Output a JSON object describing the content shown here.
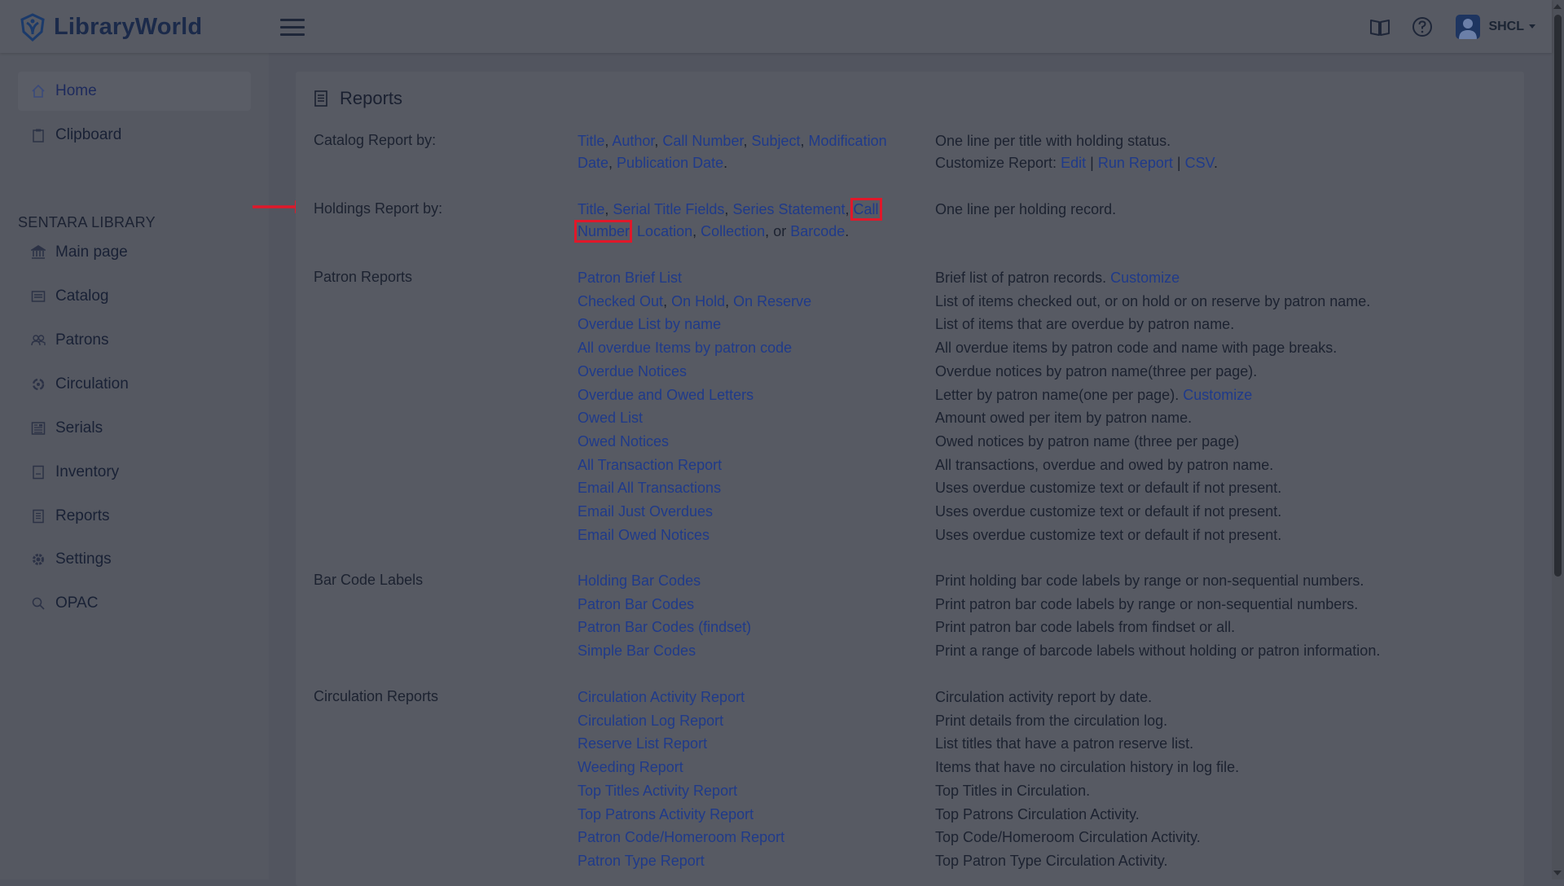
{
  "brand": {
    "name": "LibraryWorld"
  },
  "user": {
    "name": "SHCL"
  },
  "colors": {
    "link": "#1f3a8a",
    "highlight": "#e0182a",
    "brand": "#1b2a4a"
  },
  "sidebar": {
    "section": "SENTARA LIBRARY",
    "items": [
      {
        "label": "Home",
        "icon": "home-icon"
      },
      {
        "label": "Clipboard",
        "icon": "clipboard-icon"
      },
      {
        "label": "Main page",
        "icon": "bank-icon"
      },
      {
        "label": "Catalog",
        "icon": "catalog-icon"
      },
      {
        "label": "Patrons",
        "icon": "users-icon"
      },
      {
        "label": "Circulation",
        "icon": "circulation-icon"
      },
      {
        "label": "Serials",
        "icon": "serials-icon"
      },
      {
        "label": "Inventory",
        "icon": "inventory-icon"
      },
      {
        "label": "Reports",
        "icon": "reports-icon"
      },
      {
        "label": "Settings",
        "icon": "gear-icon"
      },
      {
        "label": "OPAC",
        "icon": "search-icon"
      }
    ]
  },
  "page": {
    "title": "Reports"
  },
  "catalog": {
    "label": "Catalog Report by:",
    "links": [
      "Title",
      "Author",
      "Call Number",
      "Subject",
      "Modification",
      "Date",
      "Publication Date"
    ],
    "desc1": "One line per title with holding status.",
    "desc2_prefix": "Customize Report:",
    "edit": "Edit",
    "run": "Run Report",
    "csv": "CSV"
  },
  "holdings": {
    "label": "Holdings Report by:",
    "links": [
      "Title",
      "Serial Title Fields",
      "Series Statement",
      "Call",
      "Number",
      "Location",
      "Collection",
      "Barcode"
    ],
    "or": "or",
    "desc": "One line per holding record."
  },
  "patron": {
    "label": "Patron Reports",
    "rows": [
      {
        "desc": "Brief list of patron records.",
        "extra": "Customize"
      },
      {
        "desc": "List of items checked out, or on hold or on reserve by patron name."
      },
      {
        "link": "Overdue List by name",
        "desc": "List of items that are overdue by patron name."
      },
      {
        "link": "All overdue Items by patron code",
        "desc": "All overdue items by patron code and name with page breaks."
      },
      {
        "link": "Overdue Notices",
        "desc": "Overdue notices by patron name(three per page)."
      },
      {
        "link": "Overdue and Owed Letters",
        "desc": "Letter by patron name(one per page).",
        "extra": "Customize"
      },
      {
        "link": "Owed List",
        "desc": "Amount owed per item by patron name."
      },
      {
        "link": "Owed Notices",
        "desc": "Owed notices by patron name (three per page)"
      },
      {
        "link": "All Transaction Report",
        "desc": "All transactions, overdue and owed by patron name."
      },
      {
        "link": "Email All Transactions",
        "desc": "Uses overdue customize text or default if not present."
      },
      {
        "link": "Email Just Overdues",
        "desc": "Uses overdue customize text or default if not present."
      },
      {
        "link": "Email Owed Notices",
        "desc": "Uses overdue customize text or default if not present."
      }
    ],
    "row0_link": "Patron Brief List",
    "row1_links": [
      "Checked Out",
      "On Hold",
      "On Reserve"
    ]
  },
  "barcode": {
    "label": "Bar Code Labels",
    "rows": [
      {
        "link": "Holding Bar Codes",
        "desc": "Print holding bar code labels by range or non-sequential numbers."
      },
      {
        "link": "Patron Bar Codes",
        "desc": "Print patron bar code labels by range or non-sequential numbers."
      },
      {
        "link": "Patron Bar Codes (findset)",
        "desc": "Print patron bar code labels from findset or all."
      },
      {
        "link": "Simple Bar Codes",
        "desc": "Print a range of barcode labels without holding or patron information."
      }
    ]
  },
  "circulation": {
    "label": "Circulation Reports",
    "rows": [
      {
        "link": "Circulation Activity Report",
        "desc": "Circulation activity report by date."
      },
      {
        "link": "Circulation Log Report",
        "desc": "Print details from the circulation log."
      },
      {
        "link": "Reserve List Report",
        "desc": "List titles that have a patron reserve list."
      },
      {
        "link": "Weeding Report",
        "desc": "Items that have no circulation history in log file."
      },
      {
        "link": "Top Titles Activity Report",
        "desc": "Top Titles in Circulation."
      },
      {
        "link": "Top Patrons Activity Report",
        "desc": "Top Patrons Circulation Activity."
      },
      {
        "link": "Patron Code/Homeroom Report",
        "desc": "Top Code/Homeroom Circulation Activity."
      },
      {
        "link": "Patron Type Report",
        "desc": "Top Patron Type Circulation Activity."
      }
    ]
  }
}
